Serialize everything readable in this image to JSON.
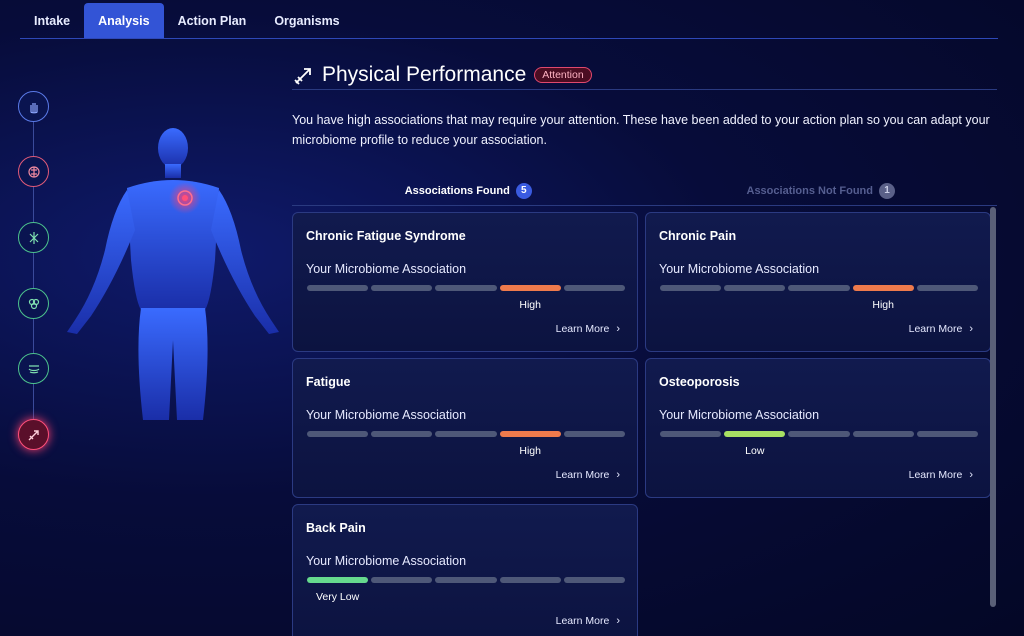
{
  "tabs": [
    {
      "label": "Intake"
    },
    {
      "label": "Analysis"
    },
    {
      "label": "Action Plan"
    },
    {
      "label": "Organisms"
    }
  ],
  "header": {
    "title": "Physical Performance",
    "badge": "Attention"
  },
  "description": "You have high associations that may require your attention. These have been added to your action plan so you can adapt your microbiome profile to reduce your association.",
  "subtabs": [
    {
      "label": "Associations Found",
      "count": "5"
    },
    {
      "label": "Associations Not Found",
      "count": "1"
    }
  ],
  "colors": {
    "high": "#ee7a4c",
    "low": "#a8e063",
    "very_low": "#66d98e",
    "accent": "#3354d6"
  },
  "cards": [
    {
      "title": "Chronic Fatigue Syndrome",
      "subtitle": "Your Microbiome Association",
      "level": "High",
      "level_index": 4,
      "link": "Learn More"
    },
    {
      "title": "Chronic Pain",
      "subtitle": "Your Microbiome Association",
      "level": "High",
      "level_index": 4,
      "link": "Learn More"
    },
    {
      "title": "Fatigue",
      "subtitle": "Your Microbiome Association",
      "level": "High",
      "level_index": 4,
      "link": "Learn More"
    },
    {
      "title": "Osteoporosis",
      "subtitle": "Your Microbiome Association",
      "level": "Low",
      "level_index": 2,
      "link": "Learn More"
    },
    {
      "title": "Back Pain",
      "subtitle": "Your Microbiome Association",
      "level": "Very Low",
      "level_index": 1,
      "link": "Learn More"
    }
  ]
}
